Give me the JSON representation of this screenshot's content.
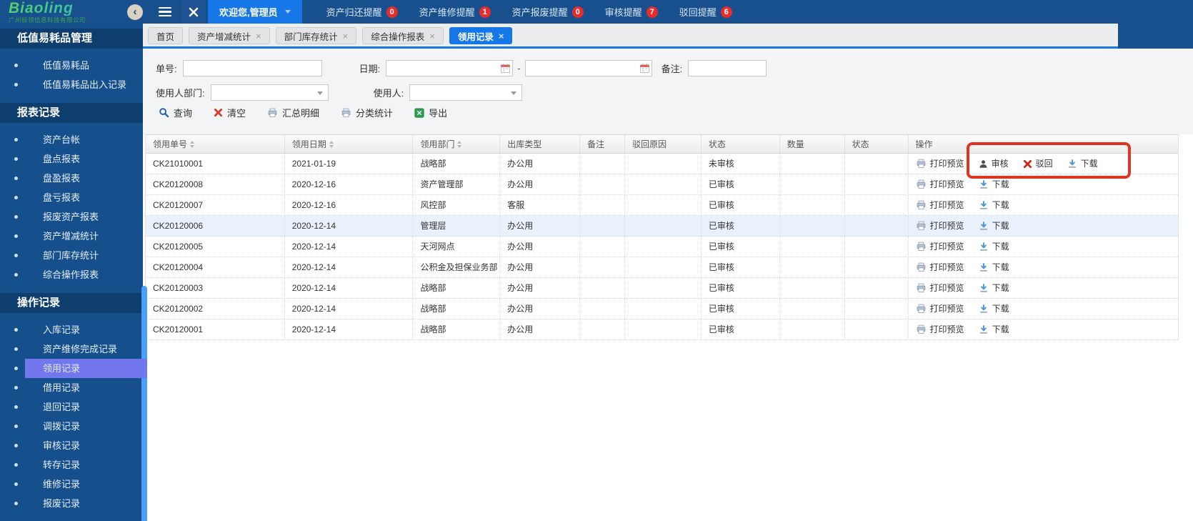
{
  "header": {
    "logo_text": "Biaoling",
    "logo_subtitle": "广州标领信息科技有限公司",
    "welcome_label": "欢迎您,管理员",
    "notifications": [
      {
        "label": "资产归还提醒",
        "count": "0"
      },
      {
        "label": "资产维修提醒",
        "count": "1"
      },
      {
        "label": "资产报废提醒",
        "count": "0"
      },
      {
        "label": "审核提醒",
        "count": "7"
      },
      {
        "label": "驳回提醒",
        "count": "6"
      }
    ]
  },
  "sidebar": {
    "sections": [
      {
        "title": "低值易耗品管理",
        "items": [
          {
            "label": "低值易耗品"
          },
          {
            "label": "低值易耗品出入记录"
          }
        ]
      },
      {
        "title": "报表记录",
        "items": [
          {
            "label": "资产台帐"
          },
          {
            "label": "盘点报表"
          },
          {
            "label": "盘盈报表"
          },
          {
            "label": "盘亏报表"
          },
          {
            "label": "报废资产报表"
          },
          {
            "label": "资产增减统计"
          },
          {
            "label": "部门库存统计"
          },
          {
            "label": "综合操作报表"
          }
        ]
      },
      {
        "title": "操作记录",
        "items": [
          {
            "label": "入库记录"
          },
          {
            "label": "资产维修完成记录"
          },
          {
            "label": "领用记录",
            "selected": true
          },
          {
            "label": "借用记录"
          },
          {
            "label": "退回记录"
          },
          {
            "label": "调拨记录"
          },
          {
            "label": "审核记录"
          },
          {
            "label": "转存记录"
          },
          {
            "label": "维修记录"
          },
          {
            "label": "报废记录"
          }
        ]
      }
    ]
  },
  "tabs": [
    {
      "label": "首页",
      "closable": false,
      "active": false
    },
    {
      "label": "资产增减统计",
      "closable": true,
      "active": false
    },
    {
      "label": "部门库存统计",
      "closable": true,
      "active": false
    },
    {
      "label": "综合操作报表",
      "closable": true,
      "active": false
    },
    {
      "label": "领用记录",
      "closable": true,
      "active": true
    }
  ],
  "filters": {
    "order_label": "单号:",
    "date_label": "日期:",
    "date_separator": "-",
    "remark_label": "备注:",
    "user_dept_label": "使用人部门:",
    "user_label": "使用人:",
    "values": {
      "order_no": "",
      "date_from": "",
      "date_to": "",
      "remark": "",
      "user_dept": "",
      "user": ""
    }
  },
  "toolbar": {
    "buttons": [
      {
        "label": "查询",
        "icon": "search",
        "name": "query-button"
      },
      {
        "label": "清空",
        "icon": "clear",
        "name": "clear-button"
      },
      {
        "label": "汇总明细",
        "icon": "printer",
        "name": "summary-detail-button"
      },
      {
        "label": "分类统计",
        "icon": "printer",
        "name": "category-stats-button"
      },
      {
        "label": "导出",
        "icon": "export",
        "name": "export-button"
      }
    ]
  },
  "table": {
    "columns": [
      {
        "label": "领用单号",
        "sortable": true
      },
      {
        "label": "领用日期",
        "sortable": true
      },
      {
        "label": "领用部门",
        "sortable": true
      },
      {
        "label": "出库类型",
        "sortable": false
      },
      {
        "label": "备注",
        "sortable": false
      },
      {
        "label": "驳回原因",
        "sortable": false
      },
      {
        "label": "状态",
        "sortable": false
      },
      {
        "label": "数量",
        "sortable": false
      },
      {
        "label": "状态",
        "sortable": false
      },
      {
        "label": "操作",
        "sortable": false
      }
    ],
    "rows": [
      {
        "no": "CK21010001",
        "date": "2021-01-19",
        "dept": "战略部",
        "out_type": "办公用",
        "remark": "",
        "reject_reason": "",
        "status": "未审核",
        "quantity": "",
        "status2": "",
        "highlighted": false,
        "actions": [
          {
            "label": "打印预览",
            "icon": "printer",
            "name": "print-preview-button"
          },
          {
            "label": "审核",
            "icon": "user",
            "name": "approve-button"
          },
          {
            "label": "驳回",
            "icon": "reject",
            "name": "reject-button"
          },
          {
            "label": "下载",
            "icon": "download",
            "name": "download-button"
          }
        ]
      },
      {
        "no": "CK20120008",
        "date": "2020-12-16",
        "dept": "资产管理部",
        "out_type": "办公用",
        "remark": "",
        "reject_reason": "",
        "status": "已审核",
        "quantity": "",
        "status2": "",
        "highlighted": false,
        "actions": [
          {
            "label": "打印预览",
            "icon": "printer",
            "name": "print-preview-button"
          },
          {
            "label": "下载",
            "icon": "download",
            "name": "download-button"
          }
        ]
      },
      {
        "no": "CK20120007",
        "date": "2020-12-16",
        "dept": "风控部",
        "out_type": "客服",
        "remark": "",
        "reject_reason": "",
        "status": "已审核",
        "quantity": "",
        "status2": "",
        "highlighted": false,
        "actions": [
          {
            "label": "打印预览",
            "icon": "printer",
            "name": "print-preview-button"
          },
          {
            "label": "下载",
            "icon": "download",
            "name": "download-button"
          }
        ]
      },
      {
        "no": "CK20120006",
        "date": "2020-12-14",
        "dept": "管理层",
        "out_type": "办公用",
        "remark": "",
        "reject_reason": "",
        "status": "已审核",
        "quantity": "",
        "status2": "",
        "highlighted": true,
        "actions": [
          {
            "label": "打印预览",
            "icon": "printer",
            "name": "print-preview-button"
          },
          {
            "label": "下载",
            "icon": "download",
            "name": "download-button"
          }
        ]
      },
      {
        "no": "CK20120005",
        "date": "2020-12-14",
        "dept": "天河网点",
        "out_type": "办公用",
        "remark": "",
        "reject_reason": "",
        "status": "已审核",
        "quantity": "",
        "status2": "",
        "highlighted": false,
        "actions": [
          {
            "label": "打印预览",
            "icon": "printer",
            "name": "print-preview-button"
          },
          {
            "label": "下载",
            "icon": "download",
            "name": "download-button"
          }
        ]
      },
      {
        "no": "CK20120004",
        "date": "2020-12-14",
        "dept": "公积金及担保业务部",
        "out_type": "办公用",
        "remark": "",
        "reject_reason": "",
        "status": "已审核",
        "quantity": "",
        "status2": "",
        "highlighted": false,
        "actions": [
          {
            "label": "打印预览",
            "icon": "printer",
            "name": "print-preview-button"
          },
          {
            "label": "下载",
            "icon": "download",
            "name": "download-button"
          }
        ]
      },
      {
        "no": "CK20120003",
        "date": "2020-12-14",
        "dept": "战略部",
        "out_type": "办公用",
        "remark": "",
        "reject_reason": "",
        "status": "已审核",
        "quantity": "",
        "status2": "",
        "highlighted": false,
        "actions": [
          {
            "label": "打印预览",
            "icon": "printer",
            "name": "print-preview-button"
          },
          {
            "label": "下载",
            "icon": "download",
            "name": "download-button"
          }
        ]
      },
      {
        "no": "CK20120002",
        "date": "2020-12-14",
        "dept": "战略部",
        "out_type": "办公用",
        "remark": "",
        "reject_reason": "",
        "status": "已审核",
        "quantity": "",
        "status2": "",
        "highlighted": false,
        "actions": [
          {
            "label": "打印预览",
            "icon": "printer",
            "name": "print-preview-button"
          },
          {
            "label": "下载",
            "icon": "download",
            "name": "download-button"
          }
        ]
      },
      {
        "no": "CK20120001",
        "date": "2020-12-14",
        "dept": "战略部",
        "out_type": "办公用",
        "remark": "",
        "reject_reason": "",
        "status": "已审核",
        "quantity": "",
        "status2": "",
        "highlighted": false,
        "actions": [
          {
            "label": "打印预览",
            "icon": "printer",
            "name": "print-preview-button"
          },
          {
            "label": "下载",
            "icon": "download",
            "name": "download-button"
          }
        ]
      }
    ]
  },
  "annotation": {
    "shape": "highlight-box",
    "color": "#e23322"
  },
  "colors": {
    "accent": "#1677e8",
    "navy": "#17508c",
    "sidebar": "#15508d",
    "sidebar_header": "#0d3e6d",
    "selected_item": "#7277ee",
    "scrollbar": "#4aa0f7",
    "badge": "#ea2b2b",
    "row_highlight": "#e9f2fc"
  }
}
